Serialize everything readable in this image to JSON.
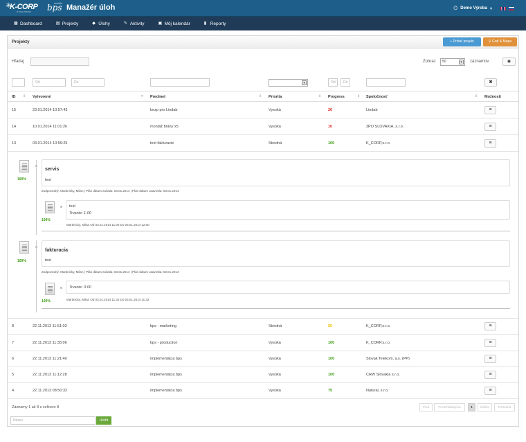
{
  "header": {
    "logo_text": "K-CORP",
    "logo_sub": "IT SOLUTIONS",
    "logo_bps": "bps",
    "logo_mobile": "mobile",
    "app_title": "Manažér úloh",
    "user_name": "Demo Výroba",
    "user_icon": "user-clock-icon"
  },
  "nav": {
    "items": [
      {
        "label": "Dashboard",
        "icon": "dashboard-icon"
      },
      {
        "label": "Projekty",
        "icon": "document-icon"
      },
      {
        "label": "Úlohy",
        "icon": "tag-icon"
      },
      {
        "label": "Aktivity",
        "icon": "pencil-icon"
      },
      {
        "label": "Môj kalendár",
        "icon": "calendar-icon"
      },
      {
        "label": "Reporty",
        "icon": "bar-chart-icon"
      }
    ]
  },
  "panel": {
    "title": "Projekty",
    "add_button": "Pridať projekt",
    "map_button": "Graf & Mapa",
    "search_label": "Hľadaj",
    "show_label": "Zobraz",
    "show_value": "50",
    "records_label": "záznamov"
  },
  "filters": {
    "date_from": "Od",
    "date_to": "Do",
    "prog_from": "Od",
    "prog_to": "Do"
  },
  "table": {
    "headers": [
      "ID",
      "Vytvorené",
      "Predmet",
      "Priorita",
      "Progress",
      "Spoločnosť",
      "Možnosti"
    ],
    "rows_top": [
      {
        "id": "15",
        "created": "23.01.2014 10:57:43",
        "subject": "bezp pro Lindab",
        "priority": "Vysoká",
        "progress": "20",
        "company": "Lindab"
      },
      {
        "id": "14",
        "created": "10.01.2014 11:01:26",
        "subject": "montáž brány x5",
        "priority": "Vysoká",
        "progress": "10",
        "company": "3PO SLOVAKIA, s.r.o."
      },
      {
        "id": "13",
        "created": "03.01.2014 10:59:25",
        "subject": "test fakturacie",
        "priority": "Stredná",
        "progress": "100",
        "company": "K_CORP,s.r.o."
      }
    ],
    "rows_bottom": [
      {
        "id": "8",
        "created": "22.11.2013 11:51:03",
        "subject": "bps - marketing",
        "priority": "Stredná",
        "progress": "50",
        "company": "K_CORP,s.r.o."
      },
      {
        "id": "7",
        "created": "22.11.2013 11:35:06",
        "subject": "bps - production",
        "priority": "Vysoká",
        "progress": "100",
        "company": "K_CORP,s.r.o."
      },
      {
        "id": "6",
        "created": "22.11.2013 11:21:40",
        "subject": "implementácia bps",
        "priority": "Vysoká",
        "progress": "100",
        "company": "Slovak Telekom, a.s. (PP)"
      },
      {
        "id": "5",
        "created": "22.11.2013 11:12:28",
        "subject": "implementácia bps",
        "priority": "Vysoká",
        "progress": "100",
        "company": "CRW Slovakia s.r.o."
      },
      {
        "id": "4",
        "created": "22.11.2013 08:50:32",
        "subject": "implementácia bps",
        "priority": "Vysoká",
        "progress": "75",
        "company": "Natural, s.r.o."
      }
    ]
  },
  "detail": {
    "tasks": [
      {
        "pct": "100%",
        "title": "servis",
        "text": "test",
        "meta": "Zodpovedný: Martinicky, Milan | Plán dátum začatia: 03.01.2014 | Plán dátum uzavretia: 03.01.2014",
        "activity": {
          "pct": "100%",
          "text": "test",
          "duration": "Trvanie: 1.00",
          "meta": "Martinicky, Milan Od 03.01.2014 11:00 Do 03.01.2014 12:00"
        }
      },
      {
        "pct": "100%",
        "title": "fakturacia",
        "text": "test",
        "meta": "Zodpovedný: Martinicky, Milan | Plán dátum začatia: 03.01.2014 | Plán dátum uzavretia: 03.01.2014",
        "activity": {
          "pct": "100%",
          "text": "",
          "duration": "Trvanie: 0.00",
          "meta": "Martinicky, Milan Od 03.01.2014 11:32 Do 03.01.2014 11:32"
        }
      }
    ]
  },
  "footer": {
    "records_info": "Záznamy 1 až 8 z celkovo 8",
    "pager": [
      "Prvá",
      "Predchádzajúca",
      "1",
      "Ďalšia",
      "Posledná"
    ],
    "goto_placeholder": "Název",
    "goto_button": "Uložit"
  }
}
